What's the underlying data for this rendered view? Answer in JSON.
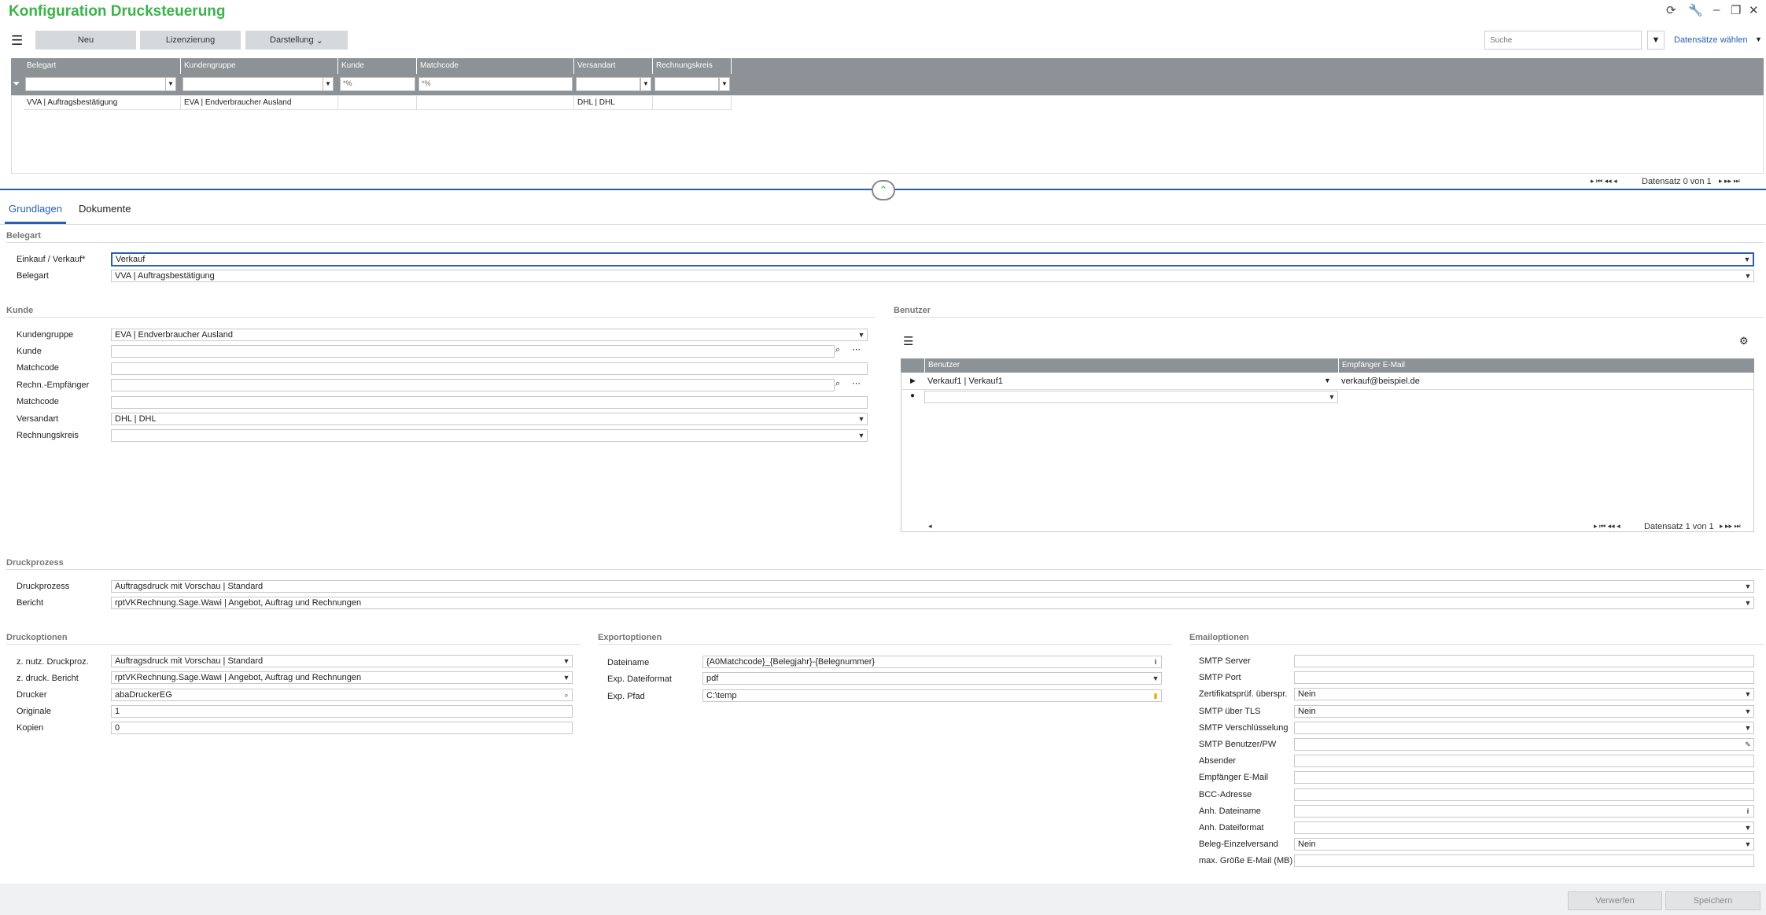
{
  "title": "Konfiguration Drucksteuerung",
  "toolbar": {
    "neu": "Neu",
    "lizenz": "Lizenzierung",
    "darstellung": "Darstellung",
    "search_placeholder": "Suche",
    "datensaetze": "Datensätze wählen"
  },
  "grid": {
    "headers": [
      "Belegart",
      "Kundengruppe",
      "Kunde",
      "Matchcode",
      "Versandart",
      "Rechnungskreis"
    ],
    "filter_kunde": "*%",
    "filter_match": "*%",
    "row": [
      "VVA  |  Auftragsbestätigung",
      "EVA  |  Endverbraucher Ausland",
      "",
      "",
      "DHL  |  DHL",
      ""
    ],
    "pager": "Datensatz 0 von 1"
  },
  "tabs": [
    "Grundlagen",
    "Dokumente"
  ],
  "belegart": {
    "section": "Belegart",
    "einkauf_label": "Einkauf / Verkauf*",
    "einkauf_value": "Verkauf",
    "belegart_label": "Belegart",
    "belegart_value": "VVA  |  Auftragsbestätigung"
  },
  "kunde": {
    "section": "Kunde",
    "fields": [
      {
        "label": "Kundengruppe",
        "value": "EVA  |  Endverbraucher Ausland"
      },
      {
        "label": "Kunde",
        "value": ""
      },
      {
        "label": "Matchcode",
        "value": ""
      },
      {
        "label": "Rechn.-Empfänger",
        "value": ""
      },
      {
        "label": "Matchcode",
        "value": ""
      },
      {
        "label": "Versandart",
        "value": "DHL  |  DHL"
      },
      {
        "label": "Rechnungskreis",
        "value": ""
      }
    ]
  },
  "benutzer": {
    "section": "Benutzer",
    "col1": "Benutzer",
    "col2": "Empfänger E-Mail",
    "row_user": "Verkauf1  |  Verkauf1",
    "row_mail": "verkauf@beispiel.de",
    "pager": "Datensatz 1 von 1"
  },
  "druckprozess": {
    "section": "Druckprozess",
    "prozess_label": "Druckprozess",
    "prozess_value": "Auftragsdruck mit Vorschau  |  Standard",
    "bericht_label": "Bericht",
    "bericht_value": "rptVKRechnung.Sage.Wawi  |  Angebot, Auftrag und Rechnungen"
  },
  "druckoptionen": {
    "section": "Druckoptionen",
    "fields": [
      {
        "label": "z. nutz. Druckproz.",
        "value": "Auftragsdruck mit Vorschau  |  Standard"
      },
      {
        "label": "z. druck. Bericht",
        "value": "rptVKRechnung.Sage.Wawi  |  Angebot, Auftrag und Rechnungen"
      },
      {
        "label": "Drucker",
        "value": "abaDruckerEG"
      },
      {
        "label": "Originale",
        "value": "1"
      },
      {
        "label": "Kopien",
        "value": "0"
      }
    ]
  },
  "export": {
    "section": "Exportoptionen",
    "fields": [
      {
        "label": "Dateiname",
        "value": "{A0Matchcode}_{Belegjahr}-{Belegnummer}"
      },
      {
        "label": "Exp. Dateiformat",
        "value": "pdf"
      },
      {
        "label": "Exp. Pfad",
        "value": "C:\\temp"
      }
    ]
  },
  "email": {
    "section": "Emailoptionen",
    "fields": [
      {
        "label": "SMTP Server",
        "value": ""
      },
      {
        "label": "SMTP Port",
        "value": ""
      },
      {
        "label": "Zertifikatsprüf. überspr.",
        "value": "Nein"
      },
      {
        "label": "SMTP über TLS",
        "value": "Nein"
      },
      {
        "label": "SMTP Verschlüsselung",
        "value": ""
      },
      {
        "label": "SMTP Benutzer/PW",
        "value": ""
      },
      {
        "label": "Absender",
        "value": ""
      },
      {
        "label": "Empfänger E-Mail",
        "value": ""
      },
      {
        "label": "BCC-Adresse",
        "value": ""
      },
      {
        "label": "Anh. Dateiname",
        "value": ""
      },
      {
        "label": "Anh. Dateiformat",
        "value": ""
      },
      {
        "label": "Beleg-Einzelversand",
        "value": "Nein"
      },
      {
        "label": "max. Größe E-Mail (MB)",
        "value": ""
      }
    ]
  },
  "footer": {
    "verwerfen": "Verwerfen",
    "speichern": "Speichern"
  }
}
